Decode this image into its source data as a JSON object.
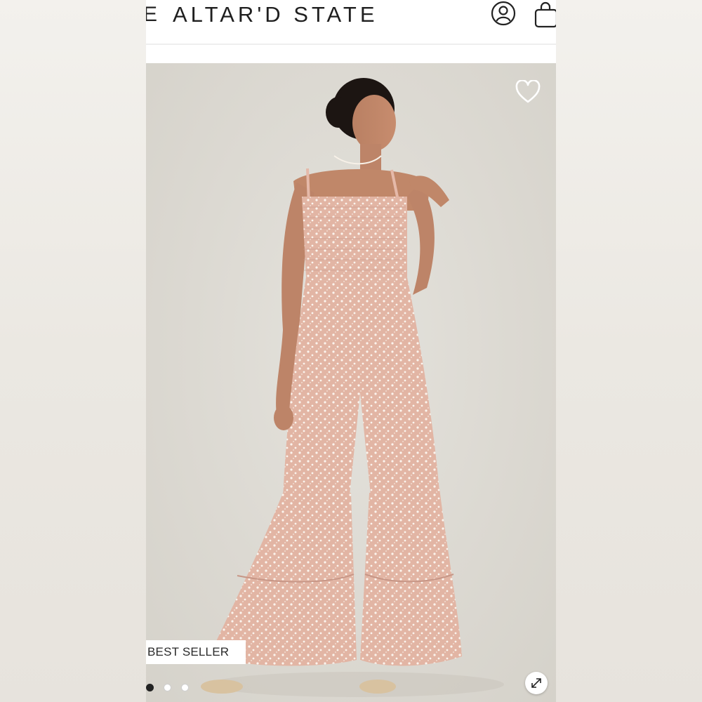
{
  "header": {
    "menu_fragment": "E",
    "brand": "ALTAR'D STATE",
    "account_icon": "account-circle-icon",
    "bag_icon": "shopping-bag-icon"
  },
  "product": {
    "badge": "BEST SELLER",
    "wishlist_icon": "heart-outline-icon",
    "zoom_icon": "expand-arrows-icon",
    "image_index": 1,
    "image_count": 3
  },
  "colors": {
    "background_frame": "#ece9e4",
    "hero_backdrop": "#dcd9d2",
    "garment_pink": "#e3b9aa",
    "text_dark": "#1f1f1f"
  }
}
